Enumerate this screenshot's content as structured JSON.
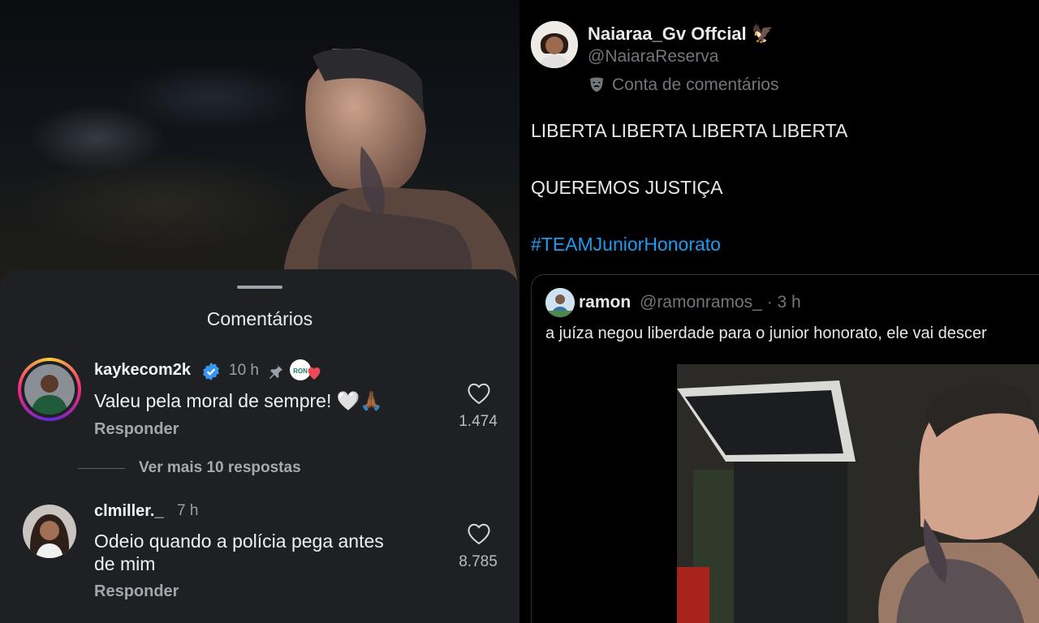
{
  "left_panel": {
    "sheet_title": "Comentários",
    "comments": [
      {
        "username": "kaykecom2k",
        "verified": true,
        "time": "10 h",
        "pinned": true,
        "text": "Valeu pela moral de sempre! 🤍🙏🏾",
        "reply_label": "Responder",
        "likes": "1.474"
      },
      {
        "username": "clmiller._",
        "verified": false,
        "time": "7 h",
        "pinned": false,
        "text_line1": "Odeio quando a polícia pega antes",
        "text_line2": "de mim",
        "reply_label": "Responder",
        "likes": "8.785"
      }
    ],
    "view_more_replies": "Ver mais 10 respostas",
    "colors": {
      "sheet_bg": "#1e2024",
      "verified": "#3897f0",
      "creator_heart": "#ed4956"
    }
  },
  "right_panel": {
    "author": {
      "display_name": "Naiaraa_Gv Offcial 🦅",
      "handle": "@NaiaraReserva",
      "account_label": "Conta de comentários"
    },
    "tweet_lines": [
      "LIBERTA LIBERTA LIBERTA LIBERTA",
      "QUEREMOS JUSTIÇA"
    ],
    "hashtag": "#TEAMJuniorHonorato",
    "quoted_tweet": {
      "name": "ramon",
      "handle_time": "@ramonramos_ · 3 h",
      "text": "a juíza negou liberdade para o junior honorato, ele vai descer"
    },
    "colors": {
      "link": "#1d9bf0",
      "secondary": "#71767b",
      "border": "#2f3336"
    }
  }
}
